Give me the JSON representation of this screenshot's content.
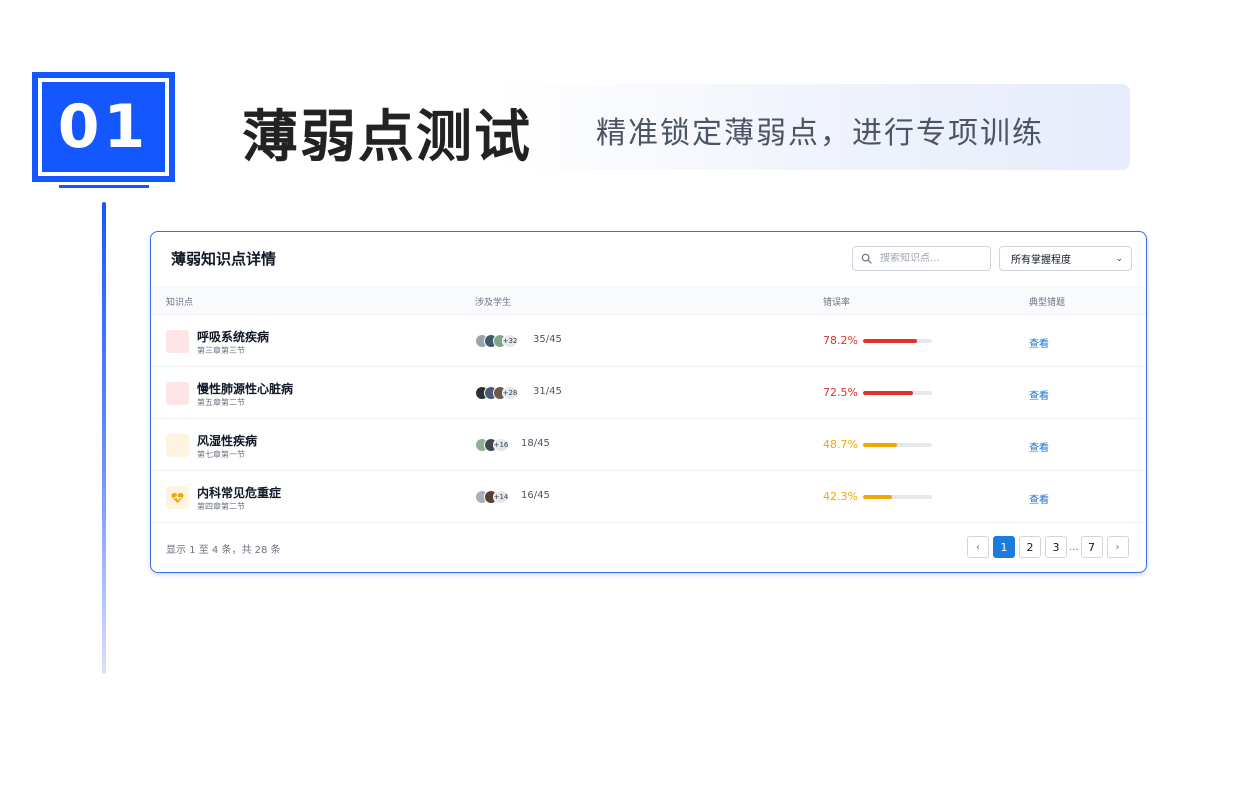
{
  "header": {
    "number": "01",
    "title": "薄弱点测试",
    "subtitle": "精准锁定薄弱点，进行专项训练"
  },
  "card": {
    "title": "薄弱知识点详情",
    "search_placeholder": "搜索知识点...",
    "filter_value": "所有掌握程度",
    "columns": {
      "knowledge": "知识点",
      "students": "涉及学生",
      "error_rate": "错误率",
      "typical": "典型错题"
    },
    "rows": [
      {
        "name": "呼吸系统疾病",
        "section": "第三章第三节",
        "more": "+32",
        "count": "35/45",
        "rate": "78.2%",
        "rate_value": 0.782,
        "color": "#e03131",
        "icon_bg": "#ffe4e6",
        "action": "查看"
      },
      {
        "name": "慢性肺源性心脏病",
        "section": "第五章第二节",
        "more": "+28",
        "count": "31/45",
        "rate": "72.5%",
        "rate_value": 0.725,
        "color": "#e03131",
        "icon_bg": "#ffe4e6",
        "action": "查看"
      },
      {
        "name": "风湿性疾病",
        "section": "第七章第一节",
        "more": "+16",
        "count": "18/45",
        "rate": "48.7%",
        "rate_value": 0.487,
        "color": "#f0a800",
        "icon_bg": "#fff4e0",
        "action": "查看"
      },
      {
        "name": "内科常见危重症",
        "section": "第四章第二节",
        "more": "+14",
        "count": "16/45",
        "rate": "42.3%",
        "rate_value": 0.423,
        "color": "#f0a800",
        "icon_bg": "#fff4e0",
        "icon": "heart-pulse-icon",
        "action": "查看"
      }
    ],
    "footer_info": "显示 1 至 4 条，共 28 条",
    "pagination": {
      "pages": [
        "1",
        "2",
        "3"
      ],
      "dots": "...",
      "last": "7",
      "current": "1"
    }
  },
  "colors": {
    "brand_blue": "#1557ff",
    "danger": "#e03131",
    "warning": "#f0a800",
    "link": "#1d6fd8"
  }
}
